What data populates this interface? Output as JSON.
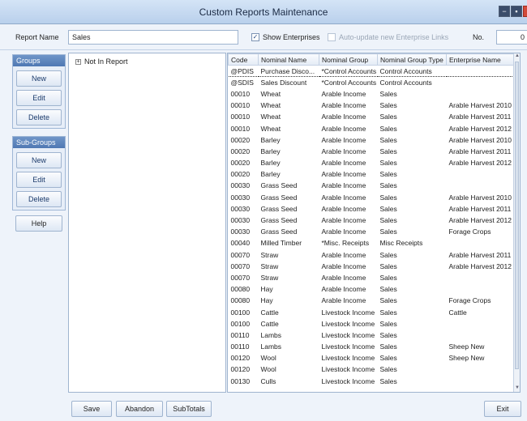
{
  "window": {
    "title": "Custom Reports Maintenance",
    "controls": {
      "min_glyph": "−",
      "max_glyph": "▪",
      "close_glyph": ""
    }
  },
  "fields": {
    "report_name_label": "Report Name",
    "report_name_value": "Sales",
    "show_enterprises_label": "Show Enterprises",
    "show_enterprises_checked": "✓",
    "auto_update_label": "Auto-update new Enterprise Links",
    "no_label": "No.",
    "no_value": "0"
  },
  "groups": {
    "header": "Groups",
    "new_label": "New",
    "edit_label": "Edit",
    "delete_label": "Delete"
  },
  "subgroups": {
    "header": "Sub-Groups",
    "new_label": "New",
    "edit_label": "Edit",
    "delete_label": "Delete"
  },
  "help_label": "Help",
  "tree": {
    "expander": "+",
    "node_label": "Not In Report"
  },
  "grid": {
    "columns": [
      "Code",
      "Nominal Name",
      "Nominal Group",
      "Nominal Group Type",
      "Enterprise Name"
    ],
    "rows": [
      [
        "@PDIS",
        "Purchase Disco...",
        "*Control Accounts",
        "Control Accounts",
        ""
      ],
      [
        "@SDIS",
        "Sales Discount",
        "*Control Accounts",
        "Control Accounts",
        ""
      ],
      [
        "00010",
        "Wheat",
        "Arable Income",
        "Sales",
        ""
      ],
      [
        "00010",
        "Wheat",
        "Arable Income",
        "Sales",
        "Arable Harvest 2010"
      ],
      [
        "00010",
        "Wheat",
        "Arable Income",
        "Sales",
        "Arable Harvest 2011"
      ],
      [
        "00010",
        "Wheat",
        "Arable Income",
        "Sales",
        "Arable Harvest 2012"
      ],
      [
        "00020",
        "Barley",
        "Arable Income",
        "Sales",
        "Arable Harvest 2010"
      ],
      [
        "00020",
        "Barley",
        "Arable Income",
        "Sales",
        "Arable Harvest 2011"
      ],
      [
        "00020",
        "Barley",
        "Arable Income",
        "Sales",
        "Arable Harvest 2012"
      ],
      [
        "00020",
        "Barley",
        "Arable Income",
        "Sales",
        ""
      ],
      [
        "00030",
        "Grass Seed",
        "Arable Income",
        "Sales",
        ""
      ],
      [
        "00030",
        "Grass Seed",
        "Arable Income",
        "Sales",
        "Arable Harvest 2010"
      ],
      [
        "00030",
        "Grass Seed",
        "Arable Income",
        "Sales",
        "Arable Harvest 2011"
      ],
      [
        "00030",
        "Grass Seed",
        "Arable Income",
        "Sales",
        "Arable Harvest 2012"
      ],
      [
        "00030",
        "Grass Seed",
        "Arable Income",
        "Sales",
        "Forage Crops"
      ],
      [
        "00040",
        "Milled Timber",
        "*Misc. Receipts",
        "Misc Receipts",
        ""
      ],
      [
        "00070",
        "Straw",
        "Arable Income",
        "Sales",
        "Arable Harvest 2011"
      ],
      [
        "00070",
        "Straw",
        "Arable Income",
        "Sales",
        "Arable Harvest 2012"
      ],
      [
        "00070",
        "Straw",
        "Arable Income",
        "Sales",
        ""
      ],
      [
        "00080",
        "Hay",
        "Arable Income",
        "Sales",
        ""
      ],
      [
        "00080",
        "Hay",
        "Arable Income",
        "Sales",
        "Forage Crops"
      ],
      [
        "00100",
        "Cattle",
        "Livestock Income",
        "Sales",
        "Cattle"
      ],
      [
        "00100",
        "Cattle",
        "Livestock Income",
        "Sales",
        ""
      ],
      [
        "00110",
        "Lambs",
        "Livestock Income",
        "Sales",
        ""
      ],
      [
        "00110",
        "Lambs",
        "Livestock Income",
        "Sales",
        "Sheep New"
      ],
      [
        "00120",
        "Wool",
        "Livestock Income",
        "Sales",
        "Sheep New"
      ],
      [
        "00120",
        "Wool",
        "Livestock Income",
        "Sales",
        ""
      ],
      [
        "00130",
        "Culls",
        "Livestock Income",
        "Sales",
        ""
      ]
    ]
  },
  "bottom": {
    "save_label": "Save",
    "abandon_label": "Abandon",
    "subtotals_label": "SubTotals",
    "exit_label": "Exit"
  }
}
